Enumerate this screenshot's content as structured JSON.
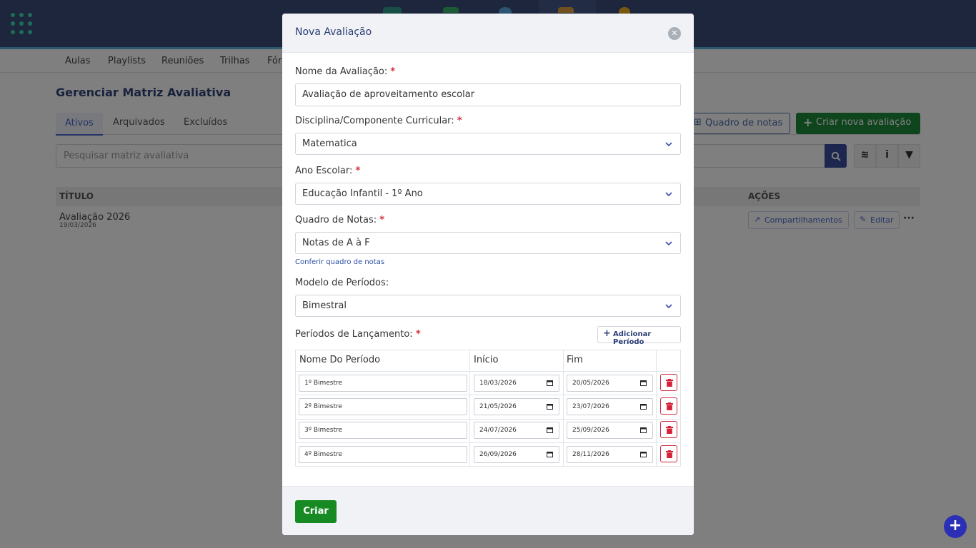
{
  "background": {
    "subnav": [
      "Aulas",
      "Playlists",
      "Reuniões",
      "Trilhas",
      "Fóruns"
    ],
    "page_title": "Gerenciar Matriz Avaliativa",
    "tabs": [
      "Ativos",
      "Arquivados",
      "Excluídos"
    ],
    "grade_board_button": "Quadro de notas",
    "create_button": "Criar nova avaliação",
    "search_placeholder": "Pesquisar matriz avaliativa",
    "table_headers": {
      "title": "TÍTULO",
      "actions": "AÇÕES"
    },
    "row": {
      "title": "Avaliação 2026",
      "date": "19/03/2026",
      "share_button": "Compartilhamentos",
      "edit_button": "Editar"
    }
  },
  "modal": {
    "title": "Nova Avaliação",
    "name_label": "Nome da Avaliação:",
    "name_value": "Avaliação de aproveitamento escolar",
    "subject_label": "Disciplina/Componente Curricular:",
    "subject_value": "Matematica",
    "year_label": "Ano Escolar:",
    "year_value": "Educação Infantil - 1º Ano",
    "grades_label": "Quadro de Notas:",
    "grades_value": "Notas de A à F",
    "check_grades_link": "Conferir quadro de notas",
    "period_model_label": "Modelo de Períodos:",
    "period_model_value": "Bimestral",
    "periods_label": "Períodos de Lançamento:",
    "add_period_button": "Adicionar Período",
    "columns": {
      "name": "Nome Do Período",
      "start": "Início",
      "end": "Fim"
    },
    "periods": [
      {
        "name": "1º Bimestre",
        "start": "18/03/2026",
        "end": "20/05/2026"
      },
      {
        "name": "2º Bimestre",
        "start": "21/05/2026",
        "end": "23/07/2026"
      },
      {
        "name": "3º Bimestre",
        "start": "24/07/2026",
        "end": "25/09/2026"
      },
      {
        "name": "4º Bimestre",
        "start": "26/09/2026",
        "end": "28/11/2026"
      }
    ],
    "required_mark": "*",
    "submit_button": "Criar"
  },
  "icons": {
    "close": "close-icon",
    "chevron": "chevron-down-icon",
    "calendar": "calendar-icon",
    "trash": "trash-icon",
    "plus": "plus-icon",
    "search": "search-icon",
    "layers": "layers-icon",
    "info": "info-icon",
    "filter": "filter-icon"
  },
  "colors": {
    "topbar": "#3a4c78",
    "primary_text": "#2b3d75",
    "create_green": "#178a24",
    "danger": "#cc2b43",
    "required": "#d62e3a"
  }
}
